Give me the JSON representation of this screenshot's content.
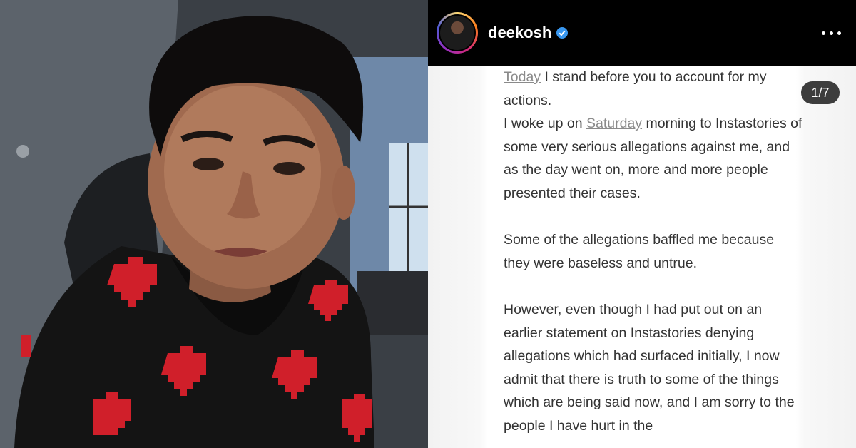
{
  "post": {
    "username": "deekosh",
    "verified": true,
    "page_counter": "1/7",
    "icons": {
      "verified": "verified-badge-icon",
      "more": "more-options-icon"
    }
  },
  "statement": {
    "p1_link": "Today",
    "p1_rest": " I stand before you to account for my actions.",
    "p2_a": "I woke up on ",
    "p2_link": "Saturday",
    "p2_b": " morning to Instastories of some very serious allegations against me, and as the day went on, more and more people presented their cases.",
    "p3": "Some of the allegations baffled me because they were baseless and untrue.",
    "p4": "However, even though I had put out on an earlier statement on Instastories denying allegations which had surfaced initially, I now admit that there is truth to some of the things which are being said now, and I am sorry to the people I have hurt in the"
  },
  "colors": {
    "link": "#8a8a8a",
    "verified": "#3897f0",
    "counter_bg": "#3d3d3d"
  }
}
